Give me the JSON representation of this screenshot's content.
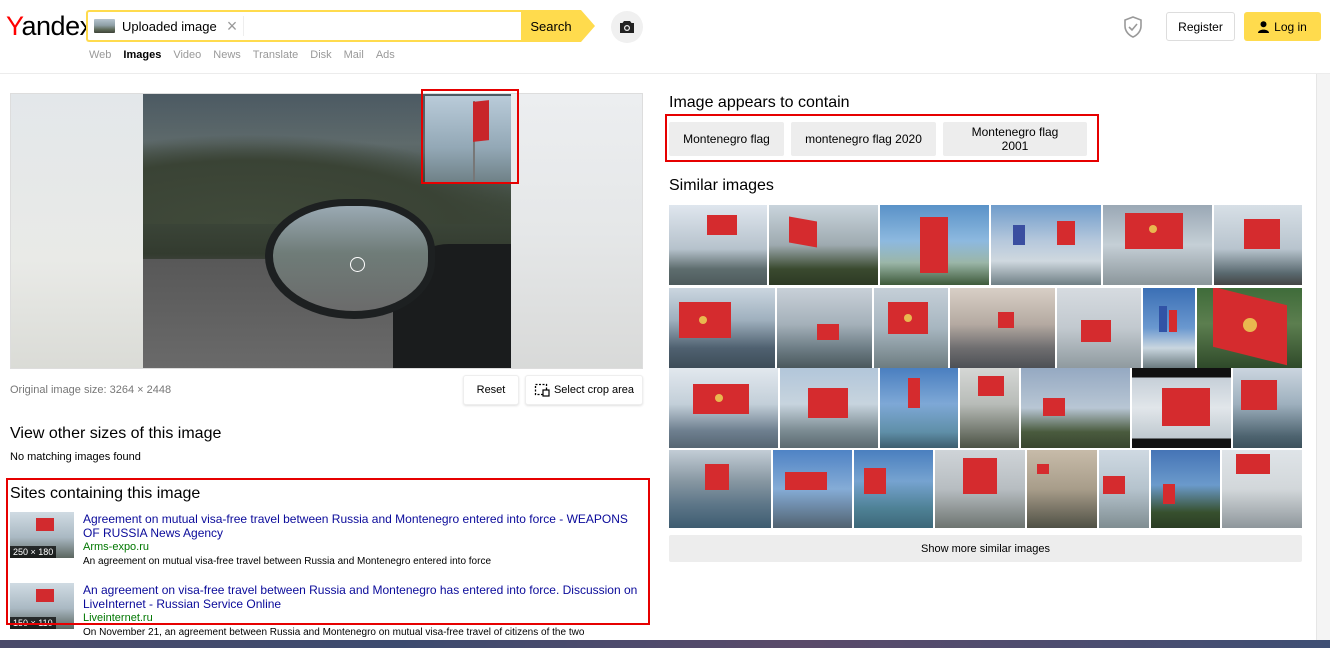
{
  "header": {
    "logo_y": "Y",
    "logo_rest": "andex",
    "search_chip_label": "Uploaded image",
    "search_chip_close": "×",
    "search_button": "Search",
    "nav": [
      "Web",
      "Images",
      "Video",
      "News",
      "Translate",
      "Disk",
      "Mail",
      "Ads"
    ],
    "nav_active": "Images",
    "register": "Register",
    "login": "Log in"
  },
  "photo": {
    "original_size": "Original image size: 3264 × 2448",
    "reset": "Reset",
    "select_crop": "Select crop area"
  },
  "other_sizes": {
    "title": "View other sizes of this image",
    "message": "No matching images found"
  },
  "sites": {
    "title": "Sites containing this image",
    "items": [
      {
        "dims": "250 × 180",
        "title": "Agreement on mutual visa-free travel between Russia and Montenegro entered into force - WEAPONS OF RUSSIA News Agency",
        "domain": "Arms-expo.ru",
        "desc": "An agreement on mutual visa-free travel between Russia and Montenegro entered into force"
      },
      {
        "dims": "150 × 110",
        "title": "An agreement on visa-free travel between Russia and Montenegro has entered into force. Discussion on LiveInternet - Russian Service Online",
        "domain": "Liveinternet.ru",
        "desc": "On November 21, an agreement between Russia and Montenegro on mutual visa-free travel of citizens of the two"
      }
    ]
  },
  "contains": {
    "title": "Image appears to contain",
    "tags": [
      "Montenegro flag",
      "montenegro flag 2020",
      "Montenegro flag 2001"
    ]
  },
  "similar": {
    "title": "Similar images",
    "show_more": "Show more similar images"
  },
  "colors": {
    "accent": "#ffdb4d",
    "highlight_box": "#e60000",
    "link": "#0a0a9a",
    "domain": "#007700",
    "flag_red": "#d52b2e"
  }
}
